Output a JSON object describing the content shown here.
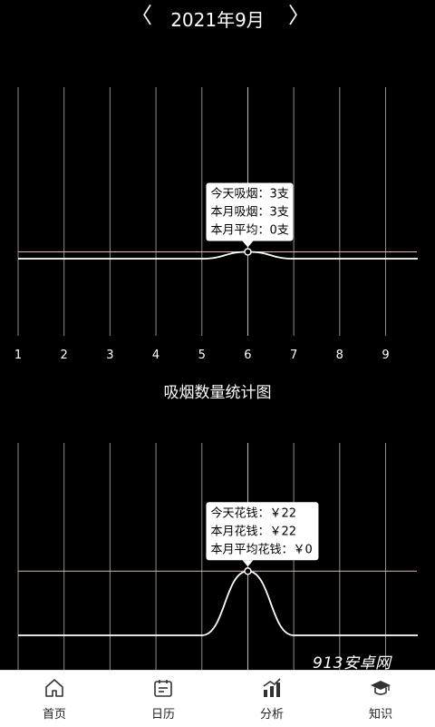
{
  "header": {
    "prev_arrow": "〈",
    "next_arrow": "〉",
    "month": "2021年9月"
  },
  "chart_data": [
    {
      "type": "line",
      "x": [
        1,
        2,
        3,
        4,
        5,
        6,
        7,
        8,
        9
      ],
      "series": [
        {
          "values": [
            0,
            0,
            0,
            0,
            0,
            3,
            0,
            0,
            0
          ]
        }
      ],
      "xlim": [
        1,
        9.7
      ],
      "ylim": [
        0,
        10
      ],
      "tick_labels": [
        "1",
        "2",
        "3",
        "4",
        "5",
        "6",
        "7",
        "8",
        "9"
      ],
      "tooltip_lines": [
        "今天吸烟：3支",
        "本月吸烟：3支",
        "本月平均：0支"
      ],
      "highlight_x": 6,
      "line_color": "#ffffff",
      "grid_color": "#ffffff",
      "crosshair_color": "#e0b7a0"
    },
    {
      "type": "line",
      "x": [
        1,
        2,
        3,
        4,
        5,
        6,
        7,
        8,
        9
      ],
      "series": [
        {
          "values": [
            0,
            0,
            0,
            0,
            0,
            22,
            0,
            0,
            0
          ]
        }
      ],
      "xlim": [
        1,
        9.7
      ],
      "ylim": [
        0,
        28
      ],
      "tooltip_lines": [
        "今天花钱：￥22",
        "本月花钱：￥22",
        "本月平均花钱：￥0"
      ],
      "highlight_x": 6,
      "line_color": "#ffffff",
      "grid_color": "#ffffff",
      "crosshair_color": "#e0b7a0"
    }
  ],
  "chart1_title": "吸烟数量统计图",
  "watermark": "913安卓网",
  "bottom_nav": {
    "items": [
      {
        "label": "首页",
        "icon": "home-icon"
      },
      {
        "label": "日历",
        "icon": "calendar-icon"
      },
      {
        "label": "分析",
        "icon": "chart-icon"
      },
      {
        "label": "知识",
        "icon": "graduation-cap-icon"
      }
    ]
  }
}
